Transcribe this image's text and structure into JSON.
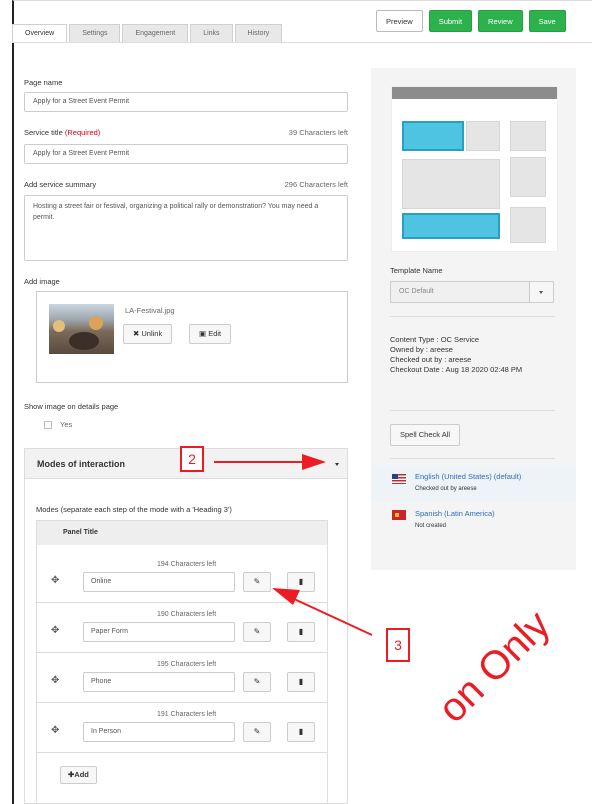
{
  "tabs": [
    "Overview",
    "Settings",
    "Engagement",
    "Links",
    "History"
  ],
  "toolbar": {
    "preview": "Preview",
    "submit": "Submit",
    "review": "Review",
    "save": "Save"
  },
  "form": {
    "page_name": {
      "label": "Page name",
      "value": "Apply for a Street Event Permit"
    },
    "service_title": {
      "label": "Service title",
      "required": "(Required)",
      "count": "39 Characters left",
      "value": "Apply for a Street Event Permit"
    },
    "summary": {
      "label": "Add service summary",
      "count": "296 Characters left",
      "value": "Hosting a street fair or festival, organizing a political rally or demonstration? You may need a permit."
    },
    "image": {
      "label": "Add image",
      "filename": "LA-Festival.jpg",
      "unlink": "Unlink",
      "edit": "Edit"
    },
    "show_image": {
      "label": "Show image on details page",
      "option": "Yes"
    }
  },
  "modes": {
    "header": "Modes of interaction",
    "instructions": "Modes (separate each step of the mode with a 'Heading 3')",
    "panel_title": "Panel Title",
    "rows": [
      {
        "count": "194 Characters left",
        "value": "Online"
      },
      {
        "count": "190 Characters left",
        "value": "Paper Form"
      },
      {
        "count": "195 Characters left",
        "value": "Phone"
      },
      {
        "count": "191 Characters left",
        "value": "In Person"
      }
    ],
    "add": "Add"
  },
  "sidebar": {
    "template_label": "Template Name",
    "template_value": "OC Default",
    "content_type": "Content Type : OC Service",
    "owned_by": "Owned by : areese",
    "checked_out_by": "Checked out by : areese",
    "checkout_date": "Checkout Date : Aug 18 2020 02:48 PM",
    "spell_check": "Spell Check All",
    "languages": [
      {
        "name": "English (United States) (default)",
        "status": "Checked out by areese"
      },
      {
        "name": "Spanish (Latin America)",
        "status": "Not created"
      }
    ]
  },
  "annotations": {
    "step2": "2",
    "step3": "3"
  },
  "watermark": "on Only",
  "colors": {
    "accent_green": "#2db14c",
    "link_blue": "#2a6ebb",
    "annotation_red": "#ec1c24",
    "template_blue": "#4fc3e2"
  }
}
